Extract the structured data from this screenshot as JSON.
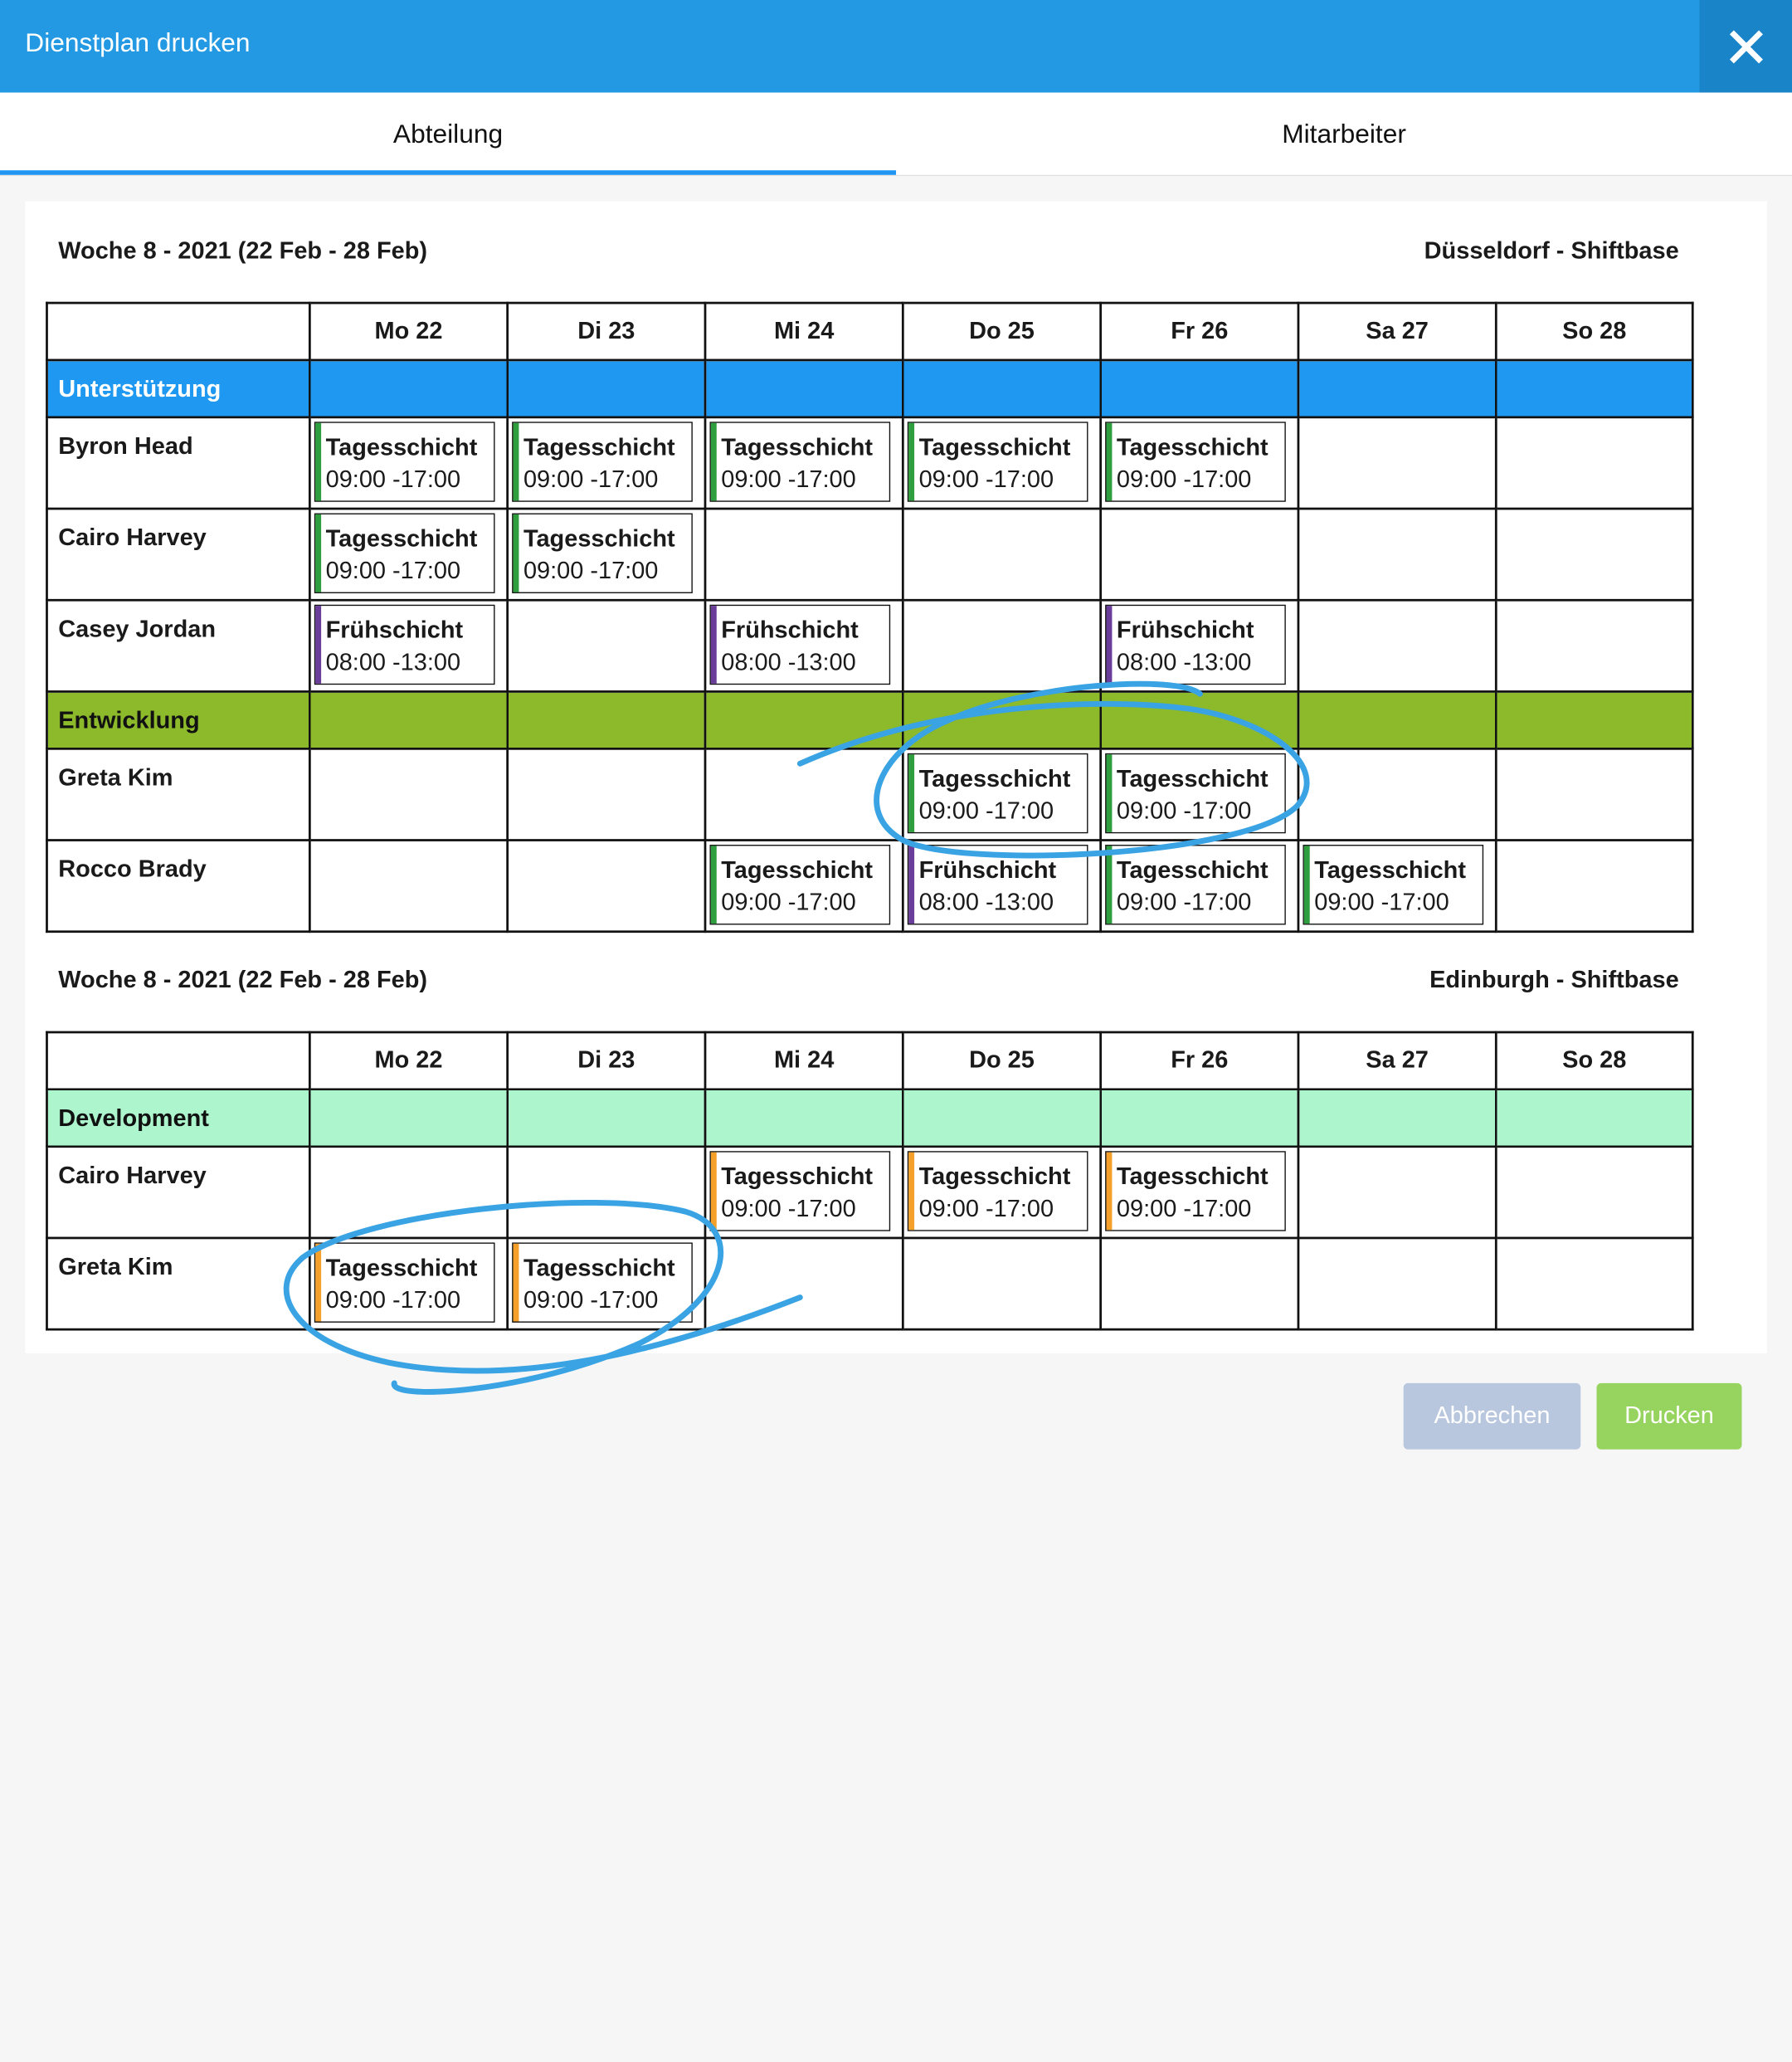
{
  "dialog": {
    "title": "Dienstplan drucken",
    "close_icon": "close-icon",
    "header_color": "#2299e2"
  },
  "tabs": [
    {
      "label": "Abteilung",
      "active": true
    },
    {
      "label": "Mitarbeiter",
      "active": false
    }
  ],
  "shift_colors": {
    "green": "#2e9e3e",
    "purple": "#6a3d9a",
    "orange": "#f5a02a"
  },
  "schedules": [
    {
      "week": "Woche 8 - 2021 (22 Feb - 28 Feb)",
      "location": "Düsseldorf - Shiftbase",
      "days": [
        "Mo 22",
        "Di 23",
        "Mi 24",
        "Do 25",
        "Fr 26",
        "Sa 27",
        "So 28"
      ],
      "departments": [
        {
          "name": "Unterstützung",
          "color": "#1e98f0",
          "text_color": "#ffffff",
          "employees": [
            {
              "name": "Byron Head",
              "shifts": [
                {
                  "day": 0,
                  "name": "Tagesschicht",
                  "time": "09:00 -17:00",
                  "color": "green"
                },
                {
                  "day": 1,
                  "name": "Tagesschicht",
                  "time": "09:00 -17:00",
                  "color": "green"
                },
                {
                  "day": 2,
                  "name": "Tagesschicht",
                  "time": "09:00 -17:00",
                  "color": "green"
                },
                {
                  "day": 3,
                  "name": "Tagesschicht",
                  "time": "09:00 -17:00",
                  "color": "green"
                },
                {
                  "day": 4,
                  "name": "Tagesschicht",
                  "time": "09:00 -17:00",
                  "color": "green"
                }
              ]
            },
            {
              "name": "Cairo Harvey",
              "shifts": [
                {
                  "day": 0,
                  "name": "Tagesschicht",
                  "time": "09:00 -17:00",
                  "color": "green"
                },
                {
                  "day": 1,
                  "name": "Tagesschicht",
                  "time": "09:00 -17:00",
                  "color": "green"
                }
              ]
            },
            {
              "name": "Casey Jordan",
              "shifts": [
                {
                  "day": 0,
                  "name": "Frühschicht",
                  "time": "08:00 -13:00",
                  "color": "purple"
                },
                {
                  "day": 2,
                  "name": "Frühschicht",
                  "time": "08:00 -13:00",
                  "color": "purple"
                },
                {
                  "day": 4,
                  "name": "Frühschicht",
                  "time": "08:00 -13:00",
                  "color": "purple"
                }
              ]
            }
          ]
        },
        {
          "name": "Entwicklung",
          "color": "#8dba2b",
          "text_color": "#111111",
          "employees": [
            {
              "name": "Greta Kim",
              "shifts": [
                {
                  "day": 3,
                  "name": "Tagesschicht",
                  "time": "09:00 -17:00",
                  "color": "green"
                },
                {
                  "day": 4,
                  "name": "Tagesschicht",
                  "time": "09:00 -17:00",
                  "color": "green"
                }
              ]
            },
            {
              "name": "Rocco Brady",
              "shifts": [
                {
                  "day": 2,
                  "name": "Tagesschicht",
                  "time": "09:00 -17:00",
                  "color": "green"
                },
                {
                  "day": 3,
                  "name": "Frühschicht",
                  "time": "08:00 -13:00",
                  "color": "purple"
                },
                {
                  "day": 4,
                  "name": "Tagesschicht",
                  "time": "09:00 -17:00",
                  "color": "green"
                },
                {
                  "day": 5,
                  "name": "Tagesschicht",
                  "time": "09:00 -17:00",
                  "color": "green"
                }
              ]
            }
          ]
        }
      ]
    },
    {
      "week": "Woche 8 - 2021 (22 Feb - 28 Feb)",
      "location": "Edinburgh - Shiftbase",
      "days": [
        "Mo 22",
        "Di 23",
        "Mi 24",
        "Do 25",
        "Fr 26",
        "Sa 27",
        "So 28"
      ],
      "departments": [
        {
          "name": "Development",
          "color": "#adf5cc",
          "text_color": "#111111",
          "employees": [
            {
              "name": "Cairo Harvey",
              "shifts": [
                {
                  "day": 2,
                  "name": "Tagesschicht",
                  "time": "09:00 -17:00",
                  "color": "orange"
                },
                {
                  "day": 3,
                  "name": "Tagesschicht",
                  "time": "09:00 -17:00",
                  "color": "orange"
                },
                {
                  "day": 4,
                  "name": "Tagesschicht",
                  "time": "09:00 -17:00",
                  "color": "orange"
                }
              ]
            },
            {
              "name": "Greta Kim",
              "shifts": [
                {
                  "day": 0,
                  "name": "Tagesschicht",
                  "time": "09:00 -17:00",
                  "color": "orange"
                },
                {
                  "day": 1,
                  "name": "Tagesschicht",
                  "time": "09:00 -17:00",
                  "color": "orange"
                }
              ]
            }
          ]
        }
      ]
    }
  ],
  "footer": {
    "cancel_label": "Abbrechen",
    "cancel_color": "#b8c7de",
    "print_label": "Drucken",
    "print_color": "#97d35f"
  },
  "annotation_color": "#3aa3e3"
}
